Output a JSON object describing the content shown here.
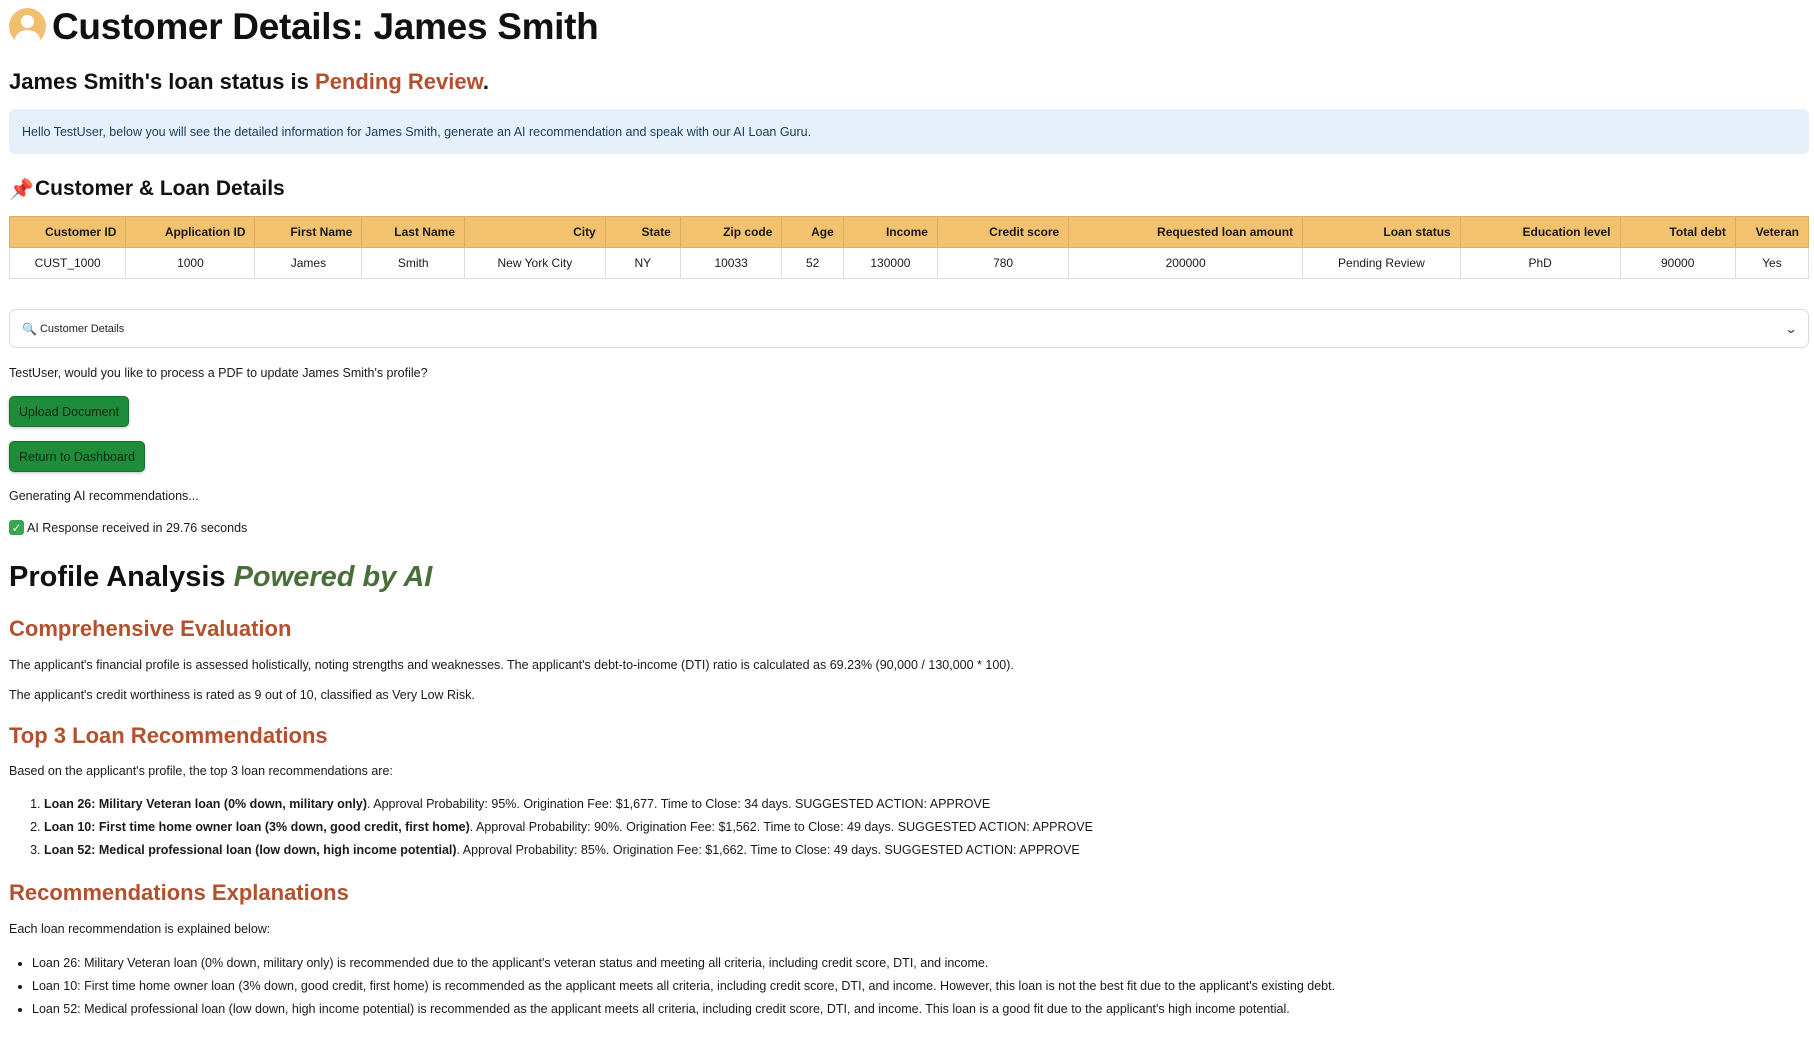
{
  "header": {
    "title": "Customer Details: James Smith"
  },
  "status": {
    "prefix": "James Smith's loan status is ",
    "value": "Pending Review",
    "suffix": ".",
    "value_color": "#b3502d"
  },
  "info_message": "Hello TestUser, below you will see the detailed information for James Smith, generate an AI recommendation and speak with our AI Loan Guru.",
  "details_section": {
    "icon": "pushpin-icon",
    "title": "Customer & Loan Details"
  },
  "table": {
    "headers": [
      "Customer ID",
      "Application ID",
      "First Name",
      "Last Name",
      "City",
      "State",
      "Zip code",
      "Age",
      "Income",
      "Credit score",
      "Requested loan amount",
      "Loan status",
      "Education level",
      "Total debt",
      "Veteran"
    ],
    "row": [
      "CUST_1000",
      "1000",
      "James",
      "Smith",
      "New York City",
      "NY",
      "10033",
      "52",
      "130000",
      "780",
      "200000",
      "Pending Review",
      "PhD",
      "90000",
      "Yes"
    ],
    "header_color": "#f2c26e"
  },
  "expander": {
    "icon": "magnifier-icon",
    "label": "Customer Details"
  },
  "upload_prompt": "TestUser, would you like to process a PDF to update James Smith's profile?",
  "buttons": {
    "upload": "Upload Document",
    "dashboard": "Return to Dashboard",
    "color": "#1e8c3a"
  },
  "generating_text": "Generating AI recommendations...",
  "response_text": "AI Response received in 29.76 seconds",
  "analysis": {
    "title": "Profile Analysis ",
    "title_accent": "Powered by AI",
    "evaluation": {
      "heading": "Comprehensive Evaluation",
      "p1": "The applicant's financial profile is assessed holistically, noting strengths and weaknesses. The applicant's debt-to-income (DTI) ratio is calculated as 69.23% (90,000 / 130,000 * 100).",
      "p2": "The applicant's credit worthiness is rated as 9 out of 10, classified as Very Low Risk."
    },
    "recommendations": {
      "heading": "Top 3 Loan Recommendations",
      "intro": "Based on the applicant's profile, the top 3 loan recommendations are:",
      "items": [
        {
          "name": "Loan 26: Military Veteran loan (0% down, military only)",
          "detail": ". Approval Probability: 95%. Origination Fee: $1,677. Time to Close: 34 days. SUGGESTED ACTION: APPROVE"
        },
        {
          "name": "Loan 10: First time home owner loan (3% down, good credit, first home)",
          "detail": ". Approval Probability: 90%. Origination Fee: $1,562. Time to Close: 49 days. SUGGESTED ACTION: APPROVE"
        },
        {
          "name": "Loan 52: Medical professional loan (low down, high income potential)",
          "detail": ". Approval Probability: 85%. Origination Fee: $1,662. Time to Close: 49 days. SUGGESTED ACTION: APPROVE"
        }
      ]
    },
    "explanations": {
      "heading": "Recommendations Explanations",
      "intro": "Each loan recommendation is explained below:",
      "items": [
        "Loan 26: Military Veteran loan (0% down, military only) is recommended due to the applicant's veteran status and meeting all criteria, including credit score, DTI, and income.",
        "Loan 10: First time home owner loan (3% down, good credit, first home) is recommended as the applicant meets all criteria, including credit score, DTI, and income. However, this loan is not the best fit due to the applicant's existing debt.",
        "Loan 52: Medical professional loan (low down, high income potential) is recommended as the applicant meets all criteria, including credit score, DTI, and income. This loan is a good fit due to the applicant's high income potential."
      ]
    }
  }
}
